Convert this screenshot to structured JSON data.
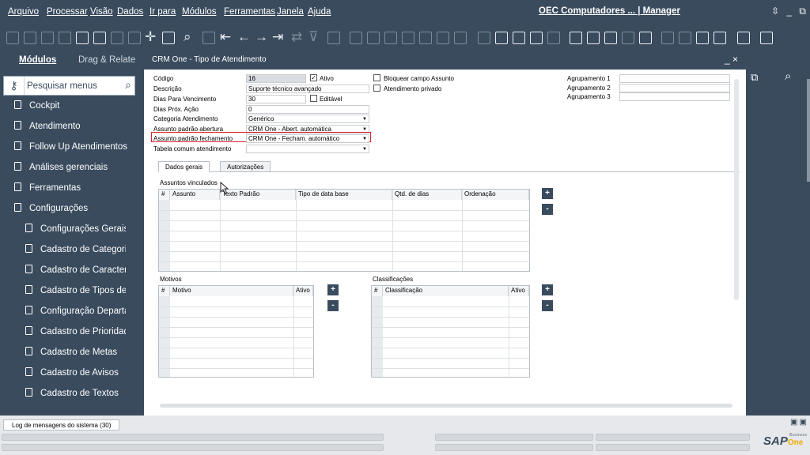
{
  "menu": [
    "Arquivo",
    "Processar",
    "Visão",
    "Dados",
    "Ir para",
    "Módulos",
    "Ferramentas",
    "Janela",
    "Ajuda"
  ],
  "company": "OEC Computadores ... | Manager",
  "window_controls": "⇳ _ ⧉",
  "sidebar": {
    "tab_modules": "Módulos",
    "tab_dragdrop": "Drag & Relate",
    "search_placeholder": "Pesquisar menus",
    "items": [
      {
        "label": "Cockpit"
      },
      {
        "label": "Atendimento"
      },
      {
        "label": "Follow Up Atendimentos"
      },
      {
        "label": "Análises gerenciais"
      },
      {
        "label": "Ferramentas"
      },
      {
        "label": "Configurações"
      }
    ],
    "subitems": [
      {
        "label": "Configurações Gerais"
      },
      {
        "label": "Cadastro de Categoria"
      },
      {
        "label": "Cadastro de Caracterí"
      },
      {
        "label": "Cadastro de Tipos de A"
      },
      {
        "label": "Configuração Departa"
      },
      {
        "label": "Cadastro de Prioridade"
      },
      {
        "label": "Cadastro de Metas"
      },
      {
        "label": "Cadastro de Avisos"
      },
      {
        "label": "Cadastro de Textos"
      }
    ]
  },
  "window": {
    "title": "CRM One - Tipo de Atendimento",
    "controls": "_ ×",
    "form": {
      "codigo_label": "Código",
      "codigo": "16",
      "ativo_label": "Ativo",
      "descricao_label": "Descrição",
      "descricao": "Suporte técnico avançado",
      "dias_venc_label": "Dias Para Vencimento",
      "dias_venc": "30",
      "editavel_label": "Editável",
      "dias_prox_label": "Dias Próx. Ação",
      "dias_prox": "0",
      "categoria_label": "Categoria Atendimento",
      "categoria": "Genérico",
      "assunto_abert_label": "Assunto padrão abertura",
      "assunto_abert": "CRM One - Abert. automática",
      "assunto_fech_label": "Assunto padrão fechamento",
      "assunto_fech": "CRM One - Fecham. automático",
      "tabela_label": "Tabela comum atendimento",
      "tabela": "",
      "bloquear_label": "Bloquear campo Assunto",
      "privado_label": "Atendimento privado",
      "agrup1_label": "Agrupamento 1",
      "agrup2_label": "Agrupamento 2",
      "agrup3_label": "Agrupamento 3"
    },
    "tabs": [
      "Dados gerais",
      "Autorizações"
    ],
    "assuntos": {
      "title": "Assuntos vinculados",
      "columns": [
        "#",
        "Assunto",
        "Texto Padrão",
        "Tipo de data base",
        "Qtd. de dias",
        "Ordenação"
      ]
    },
    "motivos": {
      "title": "Motivos",
      "columns": [
        "#",
        "Motivo",
        "Ativo"
      ]
    },
    "classificacoes": {
      "title": "Classificações",
      "columns": [
        "#",
        "Classificação",
        "Ativo"
      ]
    },
    "add": "+",
    "remove": "-"
  },
  "bottom": {
    "log_tab": "Log de mensagens do sistema (30)",
    "logo_sap": "SAP",
    "logo_business": "Business",
    "logo_one": "One"
  },
  "colors": {
    "frame": "#3a4b5e",
    "highlight": "#e0212b"
  }
}
